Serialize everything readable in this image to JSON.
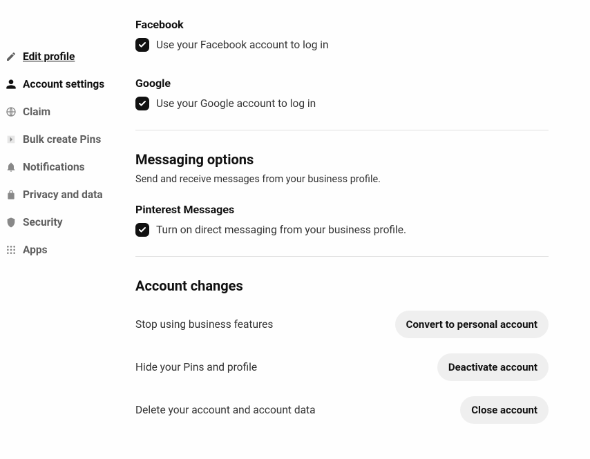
{
  "sidebar": {
    "items": [
      {
        "label": "Edit profile"
      },
      {
        "label": "Account settings"
      },
      {
        "label": "Claim"
      },
      {
        "label": "Bulk create Pins"
      },
      {
        "label": "Notifications"
      },
      {
        "label": "Privacy and data"
      },
      {
        "label": "Security"
      },
      {
        "label": "Apps"
      }
    ]
  },
  "login_options": {
    "facebook": {
      "title": "Facebook",
      "label": "Use your Facebook account to log in"
    },
    "google": {
      "title": "Google",
      "label": "Use your Google account to log in"
    }
  },
  "messaging": {
    "heading": "Messaging options",
    "description": "Send and receive messages from your business profile.",
    "pinterest": {
      "title": "Pinterest Messages",
      "label": "Turn on direct messaging from your business profile."
    }
  },
  "account_changes": {
    "heading": "Account changes",
    "rows": [
      {
        "label": "Stop using business features",
        "button": "Convert to personal account"
      },
      {
        "label": "Hide your Pins and profile",
        "button": "Deactivate account"
      },
      {
        "label": "Delete your account and account data",
        "button": "Close account"
      }
    ]
  }
}
